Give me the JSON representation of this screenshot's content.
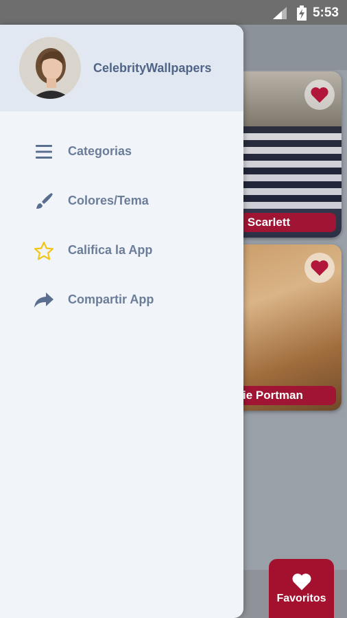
{
  "status_bar": {
    "time": "5:53"
  },
  "drawer": {
    "app_name": "CelebrityWallpapers",
    "menu": [
      {
        "label": "Categorias",
        "icon": "list-icon"
      },
      {
        "label": "Colores/Tema",
        "icon": "paintbrush-icon"
      },
      {
        "label": "Califica la App",
        "icon": "star-icon"
      },
      {
        "label": "Compartir App",
        "icon": "share-icon"
      }
    ]
  },
  "background": {
    "cards": [
      {
        "label": "Scarlett"
      },
      {
        "label": "ie Portman"
      }
    ],
    "favorites_label": "Favoritos"
  },
  "colors": {
    "accent": "#a3112f",
    "menu_text": "#6b7d98",
    "header_text": "#4f6486",
    "star": "#f2c51b"
  }
}
